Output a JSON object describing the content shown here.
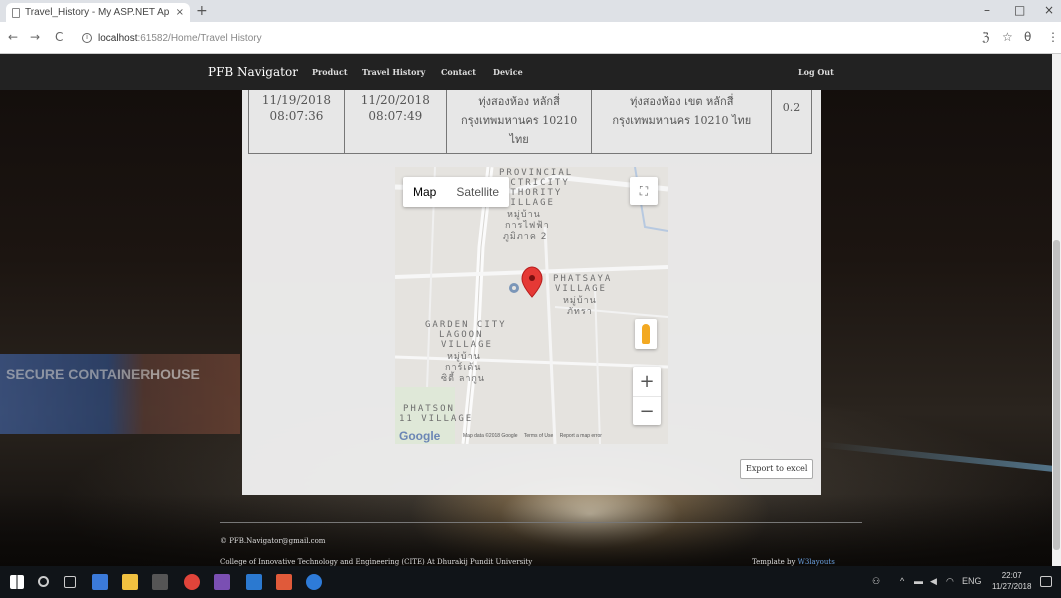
{
  "browser": {
    "tab_title": "Travel_History - My ASP.NET Ap",
    "tab_close": "×",
    "new_tab": "+",
    "url_host": "localhost",
    "url_path": ":61582/Home/Travel History",
    "back": "←",
    "forward": "→",
    "reload": "C",
    "info": "i",
    "window_minimize": "–",
    "window_maximize": "□",
    "window_close": "×",
    "bookmark_star": "☆",
    "extensions": "ℨ",
    "profile": "θ",
    "menu": "⋮"
  },
  "nav": {
    "brand": "PFB Navigator",
    "links": [
      "Product",
      "Travel History",
      "Contact",
      "Device"
    ],
    "logout": "Log Out"
  },
  "history_row": {
    "start_date": "11/19/2018",
    "start_time": "08:07:36",
    "end_date": "11/20/2018",
    "end_time": "08:07:49",
    "start_address_lines": [
      "ทุ่งสองห้อง หลักสี่",
      "กรุงเทพมหานคร 10210",
      "ไทย"
    ],
    "end_address_lines": [
      "ทุ่งสองห้อง เขต หลักสี่",
      "กรุงเทพมหานคร 10210 ไทย"
    ],
    "distance": "0.2"
  },
  "map": {
    "type_map": "Map",
    "type_satellite": "Satellite",
    "fullscreen_glyph": "⛶",
    "zoom_in": "+",
    "zoom_out": "−",
    "labels": {
      "provincial": "PROVINCIAL",
      "electricity": "ECTRICITY",
      "authority": "ITHORITY",
      "village_top": "VILLAGE",
      "thai_top_1": "หมู่บ้าน",
      "thai_top_2": "การไฟฟ้า",
      "thai_top_3": "ภูมิภาค 2",
      "phatsaya": "PHATSAYA",
      "village_right": "VILLAGE",
      "thai_right_1": "หมู่บ้าน",
      "thai_right_2": "ภัทรา",
      "garden_city": "GARDEN CITY",
      "lagoon": "LAGOON",
      "village_mid": "VILLAGE",
      "thai_mid_1": "หมู่บ้าน",
      "thai_mid_2": "การ์เด้น",
      "thai_mid_3": "ซิตี้ ลากูน",
      "phatson": "PHATSON",
      "village_bottom": "11 VILLAGE"
    },
    "google": "Google",
    "footer": [
      "Map data ©2018 Google",
      "Terms of Use",
      "Report a map error"
    ]
  },
  "export_label": "Export to excel",
  "footer": {
    "copyright": "© PFB.Navigator@gmail.com",
    "college": "College of Innovative Technology and Engineering (CITE) At Dhurakij Pundit University",
    "template_prefix": "Template by",
    "template_author": "W3layouts"
  },
  "taskbar": {
    "lang": "ENG",
    "time": "22:07",
    "date": "11/27/2018"
  },
  "colors": {
    "navbar": "#222222",
    "marker": "#e53935",
    "pegman": "#f3a922"
  }
}
